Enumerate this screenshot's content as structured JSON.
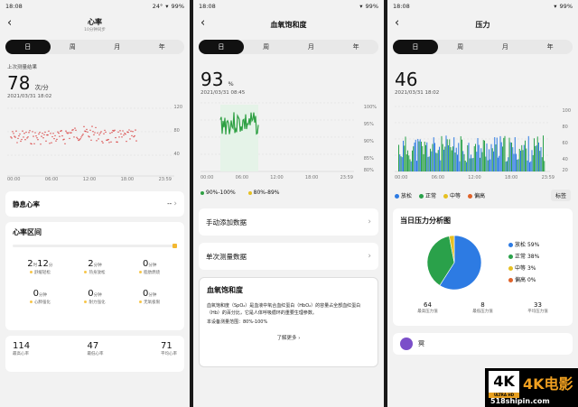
{
  "status": {
    "time": "18:08",
    "temp": "24°",
    "battery": "99%"
  },
  "colors": {
    "heart_red": "#d94040",
    "oxy_green": "#2ea043",
    "relax_blue": "#2d7be3",
    "normal_green": "#2aa14a",
    "mid_yellow": "#e6c022",
    "high_orange": "#e0632a"
  },
  "tabs": [
    "日",
    "周",
    "月",
    "年"
  ],
  "heart": {
    "title": "心率",
    "subtitle": "10分钟同步",
    "last_label": "上次测量结果",
    "value": "78",
    "unit": "次/分",
    "date": "2021/03/31 18:02",
    "y_ticks": [
      "120",
      "80",
      "40"
    ],
    "x_ticks": [
      "00:00",
      "06:00",
      "12:00",
      "18:00",
      "23:59"
    ],
    "resting_label": "静息心率",
    "resting_value": "--",
    "zone_title": "心率区间",
    "zones": [
      {
        "hours": "2",
        "h_unit": "时",
        "mins": "12",
        "m_unit": "分",
        "label": "舒缓轻松"
      },
      {
        "hours": "",
        "h_unit": "",
        "mins": "2",
        "m_unit": "分钟",
        "label": "热身放松"
      },
      {
        "hours": "",
        "h_unit": "",
        "mins": "0",
        "m_unit": "分钟",
        "label": "脂肪燃烧"
      },
      {
        "hours": "",
        "h_unit": "",
        "mins": "0",
        "m_unit": "分钟",
        "label": "心肺强化"
      },
      {
        "hours": "",
        "h_unit": "",
        "mins": "0",
        "m_unit": "分钟",
        "label": "耐力强化"
      },
      {
        "hours": "",
        "h_unit": "",
        "mins": "0",
        "m_unit": "分钟",
        "label": "无氧极限"
      }
    ],
    "stats": [
      {
        "value": "114",
        "label": "最高心率"
      },
      {
        "value": "47",
        "label": "最低心率"
      },
      {
        "value": "71",
        "label": "平均心率"
      }
    ]
  },
  "oxygen": {
    "title": "血氧饱和度",
    "value": "93",
    "unit": "%",
    "date": "2021/03/31 08:45",
    "y_ticks": [
      "100%",
      "95%",
      "90%",
      "85%",
      "80%"
    ],
    "x_ticks": [
      "00:00",
      "06:00",
      "12:00",
      "18:00",
      "23:59"
    ],
    "legend": [
      "90%-100%",
      "80%-89%"
    ],
    "add_label": "手动添加数据",
    "single_label": "单次测量数据",
    "info_title": "血氧饱和度",
    "info_text": "血氧饱和度（SpO₂）是血液中氧合血红蛋白（HbO₂）的容量占全部血红蛋白（Hb）的百分比，它是人体呼吸循环的重要生理参数。",
    "info_range": "本设备测量范围：80%-100%",
    "more_label": "了解更多"
  },
  "stress": {
    "title": "压力",
    "value": "46",
    "date": "2021/03/31 18:02",
    "y_ticks": [
      "100",
      "80",
      "60",
      "40",
      "20"
    ],
    "x_ticks": [
      "00:00",
      "06:00",
      "12:00",
      "18:00",
      "23:59"
    ],
    "legend": [
      "放松",
      "正常",
      "中等",
      "偏高"
    ],
    "tag_label": "标签",
    "analysis_title": "当日压力分析图",
    "pie_legend": [
      {
        "name": "放松",
        "pct": "59%"
      },
      {
        "name": "正常",
        "pct": "38%"
      },
      {
        "name": "中等",
        "pct": "3%"
      },
      {
        "name": "偏高",
        "pct": "0%"
      }
    ],
    "pie_values": [
      59,
      38,
      3,
      0
    ],
    "stats": [
      {
        "value": "64",
        "label": "最高压力值"
      },
      {
        "value": "8",
        "label": "最低压力值"
      },
      {
        "value": "33",
        "label": "平均压力值"
      }
    ],
    "bottom_label": "冥"
  },
  "watermark": {
    "big": "4K",
    "sub": "ULTRA HD",
    "brand": "4K电影",
    "url": "518shipin.com"
  }
}
